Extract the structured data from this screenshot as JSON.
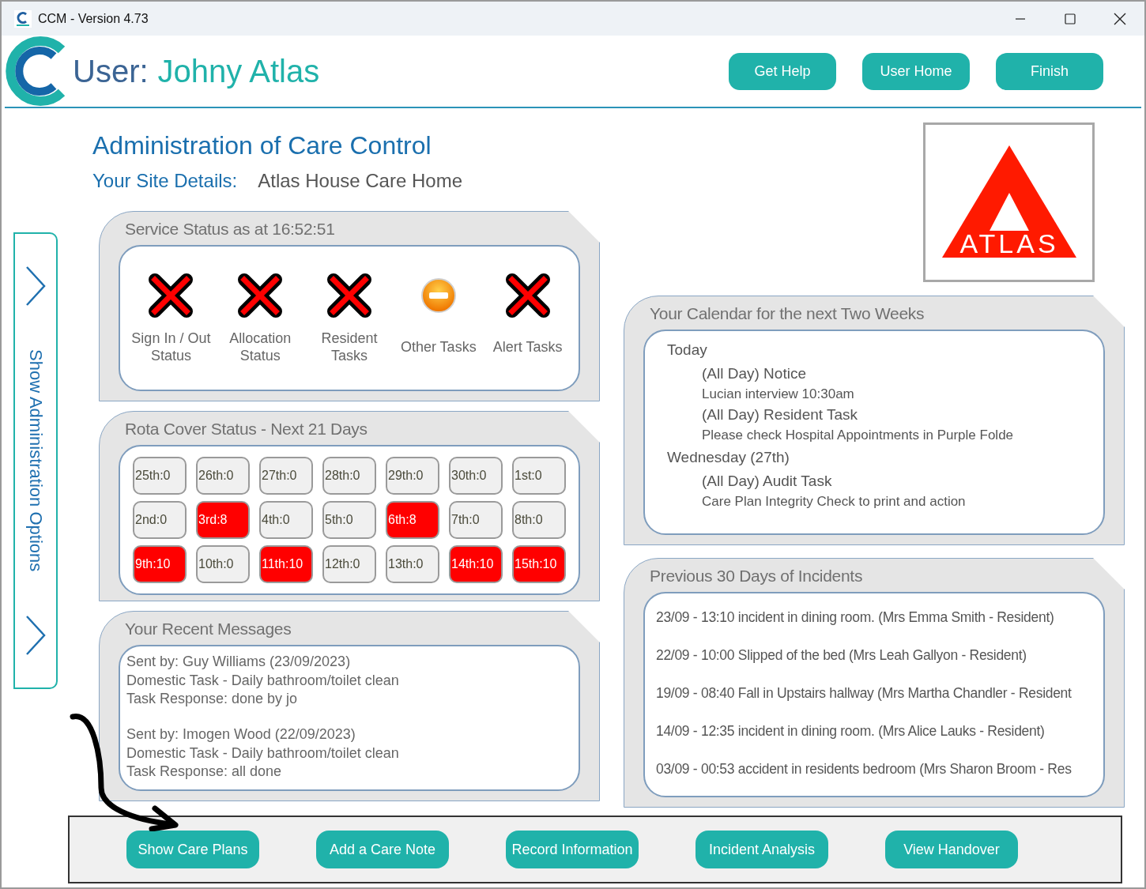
{
  "window": {
    "title": "CCM - Version 4.73"
  },
  "header": {
    "user_label": "User:",
    "user_name": "Johny Atlas",
    "buttons": [
      "Get Help",
      "User Home",
      "Finish"
    ]
  },
  "page_title": "Administration of Care Control",
  "site": {
    "label": "Your Site Details:",
    "value": "Atlas House Care Home"
  },
  "logo": {
    "text": "ATLAS"
  },
  "sidebar_tab": {
    "label": "Show Administration Options"
  },
  "service_status": {
    "title": "Service Status as at 16:52:51",
    "items": [
      {
        "label": "Sign In / Out Status",
        "kind": "fail"
      },
      {
        "label": "Allocation Status",
        "kind": "fail"
      },
      {
        "label": "Resident Tasks",
        "kind": "fail"
      },
      {
        "label": "Other Tasks",
        "kind": "partial"
      },
      {
        "label": "Alert Tasks",
        "kind": "fail"
      }
    ]
  },
  "rota": {
    "title": "Rota Cover Status - Next 21 Days",
    "days": [
      {
        "label": "25th:0",
        "flagged": false
      },
      {
        "label": "26th:0",
        "flagged": false
      },
      {
        "label": "27th:0",
        "flagged": false
      },
      {
        "label": "28th:0",
        "flagged": false
      },
      {
        "label": "29th:0",
        "flagged": false
      },
      {
        "label": "30th:0",
        "flagged": false
      },
      {
        "label": "1st:0",
        "flagged": false
      },
      {
        "label": "2nd:0",
        "flagged": false
      },
      {
        "label": "3rd:8",
        "flagged": true
      },
      {
        "label": "4th:0",
        "flagged": false
      },
      {
        "label": "5th:0",
        "flagged": false
      },
      {
        "label": "6th:8",
        "flagged": true
      },
      {
        "label": "7th:0",
        "flagged": false
      },
      {
        "label": "8th:0",
        "flagged": false
      },
      {
        "label": "9th:10",
        "flagged": true
      },
      {
        "label": "10th:0",
        "flagged": false
      },
      {
        "label": "11th:10",
        "flagged": true
      },
      {
        "label": "12th:0",
        "flagged": false
      },
      {
        "label": "13th:0",
        "flagged": false
      },
      {
        "label": "14th:10",
        "flagged": true
      },
      {
        "label": "15th:10",
        "flagged": true
      }
    ]
  },
  "messages": {
    "title": "Your Recent Messages",
    "items": [
      {
        "sender": "Sent by: Guy Williams (23/09/2023)",
        "lines": [
          "Domestic Task - Daily bathroom/toilet clean",
          "Task Response: done by jo"
        ]
      },
      {
        "sender": "Sent by: Imogen Wood (22/09/2023)",
        "lines": [
          "Domestic Task - Daily bathroom/toilet clean",
          "Task Response: all done"
        ]
      }
    ]
  },
  "calendar": {
    "title": "Your Calendar for the next Two Weeks",
    "days": [
      {
        "day": "Today",
        "events": [
          {
            "title": "(All Day) Notice",
            "detail": "Lucian interview 10:30am"
          },
          {
            "title": "(All Day) Resident Task",
            "detail": "Please check Hospital Appointments in Purple Folde"
          }
        ]
      },
      {
        "day": "Wednesday (27th)",
        "events": [
          {
            "title": "(All Day) Audit Task",
            "detail": "Care Plan Integrity Check to print and action"
          }
        ]
      }
    ]
  },
  "incidents": {
    "title": "Previous 30 Days of Incidents",
    "items": [
      "23/09 - 13:10 incident in dining room. (Mrs Emma Smith - Resident)",
      "22/09 - 10:00 Slipped of the bed (Mrs Leah Gallyon - Resident)",
      "19/09 - 08:40 Fall in Upstairs hallway (Mrs Martha Chandler - Resident",
      "14/09 - 12:35 incident in dining room. (Mrs Alice Lauks - Resident)",
      "03/09 - 00:53 accident in residents bedroom (Mrs Sharon Broom - Res"
    ]
  },
  "action_bar": {
    "buttons": [
      "Show Care Plans",
      "Add a Care Note",
      "Record Information",
      "Incident Analysis",
      "View Handover"
    ]
  }
}
